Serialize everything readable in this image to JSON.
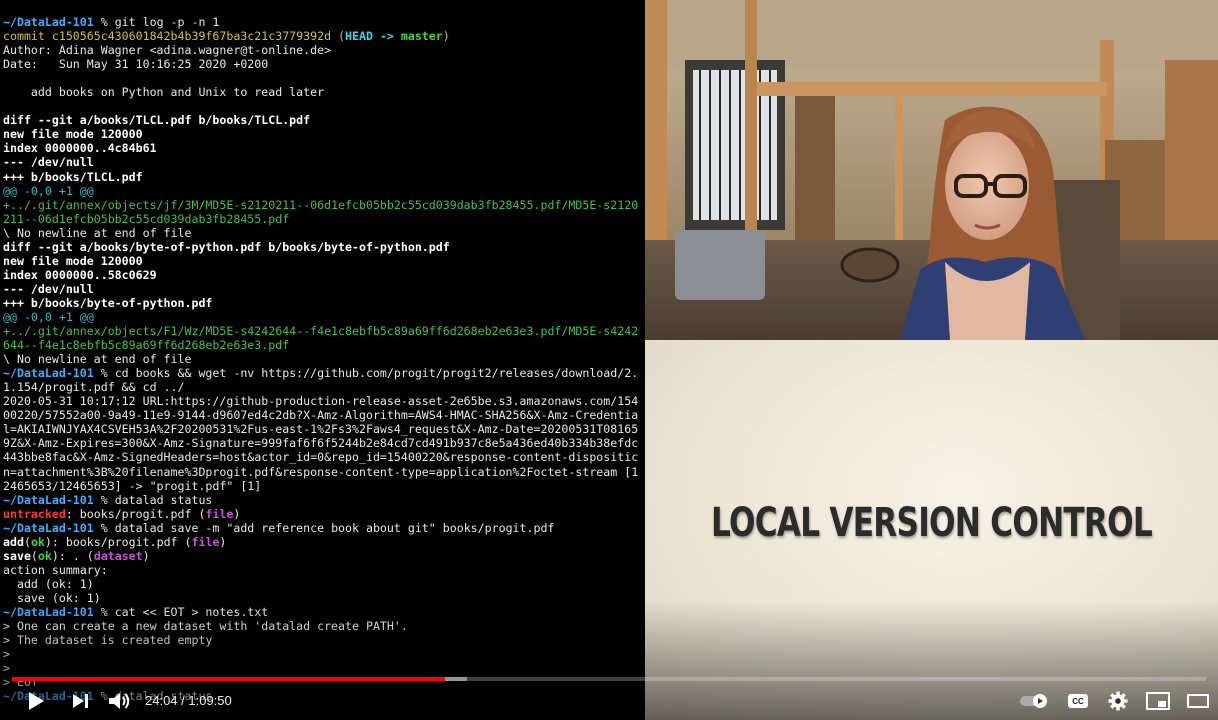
{
  "terminal": {
    "lines": [
      [
        {
          "t": "~/DataLad-101",
          "c": "c-prompt"
        },
        {
          "t": " % git log -p -n 1"
        }
      ],
      [
        {
          "t": "commit c150565c430601842b4b39f67ba3c21c3779392d (",
          "c": "c-yellow"
        },
        {
          "t": "HEAD -> ",
          "c": "c-cyan"
        },
        {
          "t": "master",
          "c": "c-green"
        },
        {
          "t": ")",
          "c": "c-yellow"
        }
      ],
      [
        {
          "t": "Author: Adina Wagner <adina.wagner@t-online.de>"
        }
      ],
      [
        {
          "t": "Date:   Sun May 31 10:16:25 2020 +0200"
        }
      ],
      [
        {
          "t": ""
        }
      ],
      [
        {
          "t": "    add books on Python and Unix to read later"
        }
      ],
      [
        {
          "t": ""
        }
      ],
      [
        {
          "t": "diff --git a/books/TLCL.pdf b/books/TLCL.pdf",
          "c": "c-white"
        }
      ],
      [
        {
          "t": "new file mode 120000",
          "c": "c-white"
        }
      ],
      [
        {
          "t": "index 0000000..4c84b61",
          "c": "c-white"
        }
      ],
      [
        {
          "t": "--- /dev/null",
          "c": "c-white"
        }
      ],
      [
        {
          "t": "+++ b/books/TLCL.pdf",
          "c": "c-white"
        }
      ],
      [
        {
          "t": "@@ -0,0 +1 @@",
          "c": "c-cyanplain"
        }
      ],
      [
        {
          "t": "+../.git/annex/objects/jf/3M/MD5E-s2120211--06d1efcb05bb2c55cd039dab3fb28455.pdf/MD5E-s2120",
          "c": "c-green-plain"
        }
      ],
      [
        {
          "t": "211--06d1efcb05bb2c55cd039dab3fb28455.pdf",
          "c": "c-green-plain"
        }
      ],
      [
        {
          "t": "\\ No newline at end of file"
        }
      ],
      [
        {
          "t": "diff --git a/books/byte-of-python.pdf b/books/byte-of-python.pdf",
          "c": "c-white"
        }
      ],
      [
        {
          "t": "new file mode 120000",
          "c": "c-white"
        }
      ],
      [
        {
          "t": "index 0000000..58c0629",
          "c": "c-white"
        }
      ],
      [
        {
          "t": "--- /dev/null",
          "c": "c-white"
        }
      ],
      [
        {
          "t": "+++ b/books/byte-of-python.pdf",
          "c": "c-white"
        }
      ],
      [
        {
          "t": "@@ -0,0 +1 @@",
          "c": "c-cyanplain"
        }
      ],
      [
        {
          "t": "+../.git/annex/objects/F1/Wz/MD5E-s4242644--f4e1c8ebfb5c89a69ff6d268eb2e63e3.pdf/MD5E-s4242",
          "c": "c-green-plain"
        }
      ],
      [
        {
          "t": "644--f4e1c8ebfb5c89a69ff6d268eb2e63e3.pdf",
          "c": "c-green-plain"
        }
      ],
      [
        {
          "t": "\\ No newline at end of file"
        }
      ],
      [
        {
          "t": "~/DataLad-101",
          "c": "c-prompt"
        },
        {
          "t": " % cd books && wget -nv https://github.com/progit/progit2/releases/download/2."
        }
      ],
      [
        {
          "t": "1.154/progit.pdf && cd ../"
        }
      ],
      [
        {
          "t": "2020-05-31 10:17:12 URL:https://github-production-release-asset-2e65be.s3.amazonaws.com/154"
        }
      ],
      [
        {
          "t": "00220/57552a00-9a49-11e9-9144-d9607ed4c2db?X-Amz-Algorithm=AWS4-HMAC-SHA256&X-Amz-Credentia"
        }
      ],
      [
        {
          "t": "l=AKIAIWNJYAX4CSVEH53A%2F20200531%2Fus-east-1%2Fs3%2Faws4_request&X-Amz-Date=20200531T08165"
        }
      ],
      [
        {
          "t": "9Z&X-Amz-Expires=300&X-Amz-Signature=999faf6f6f5244b2e84cd7cd491b937c8e5a436ed40b334b38efdc"
        }
      ],
      [
        {
          "t": "443bbe8fac&X-Amz-SignedHeaders=host&actor_id=0&repo_id=15400220&response-content-dispositic"
        }
      ],
      [
        {
          "t": "n=attachment%3B%20filename%3Dprogit.pdf&response-content-type=application%2Foctet-stream [1"
        }
      ],
      [
        {
          "t": "2465653/12465653] -> \"progit.pdf\" [1]"
        }
      ],
      [
        {
          "t": "~/DataLad-101",
          "c": "c-prompt"
        },
        {
          "t": " % datalad status"
        }
      ],
      [
        {
          "t": "untracked",
          "c": "c-red"
        },
        {
          "t": ": books/progit.pdf ("
        },
        {
          "t": "file",
          "c": "c-magenta"
        },
        {
          "t": ")"
        }
      ],
      [
        {
          "t": "~/DataLad-101",
          "c": "c-prompt"
        },
        {
          "t": " % datalad save -m \"add reference book about git\" books/progit.pdf"
        }
      ],
      [
        {
          "t": "add",
          "c": "c-white"
        },
        {
          "t": "("
        },
        {
          "t": "ok",
          "c": "c-green"
        },
        {
          "t": "): books/progit.pdf ("
        },
        {
          "t": "file",
          "c": "c-magenta"
        },
        {
          "t": ")"
        }
      ],
      [
        {
          "t": "save",
          "c": "c-white"
        },
        {
          "t": "("
        },
        {
          "t": "ok",
          "c": "c-green"
        },
        {
          "t": "): . ("
        },
        {
          "t": "dataset",
          "c": "c-magenta"
        },
        {
          "t": ")"
        }
      ],
      [
        {
          "t": "action summary:"
        }
      ],
      [
        {
          "t": "  add (ok: 1)"
        }
      ],
      [
        {
          "t": "  save (ok: 1)"
        }
      ],
      [
        {
          "t": "~/DataLad-101",
          "c": "c-prompt"
        },
        {
          "t": " % cat << EOT > notes.txt"
        }
      ],
      [
        {
          "t": "> One can create a new dataset with 'datalad create PATH'."
        }
      ],
      [
        {
          "t": "> The dataset is created empty"
        }
      ],
      [
        {
          "t": ">"
        }
      ],
      [
        {
          "t": ">"
        }
      ],
      [
        {
          "t": "> EOT"
        }
      ],
      [
        {
          "t": "~/DataLad-101",
          "c": "c-prompt"
        },
        {
          "t": " % datalad status"
        }
      ]
    ]
  },
  "slide": {
    "title": "LOCAL VERSION CONTROL",
    "background": "#f2ecdd"
  },
  "player": {
    "time_current": "24:04",
    "time_separator": " / ",
    "time_total": "1:09:50",
    "progress_played": 0.363,
    "progress_buffered": 0.381,
    "accent_color": "#ff0000",
    "icons": [
      "play-icon",
      "next-icon",
      "volume-icon",
      "autoplay-toggle-icon",
      "captions-icon",
      "settings-icon",
      "miniplayer-icon",
      "theater-mode-icon"
    ],
    "captions_label": "CC"
  }
}
